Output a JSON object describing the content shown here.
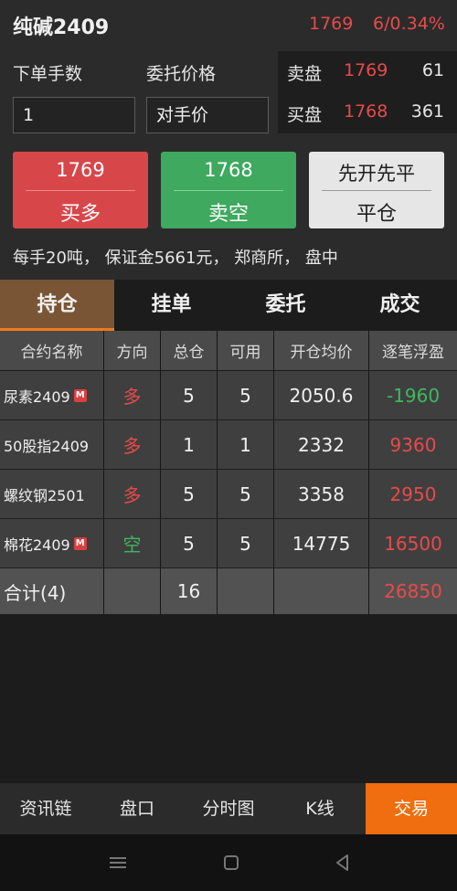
{
  "header": {
    "title": "纯碱2409",
    "last_price": "1769",
    "change": "6/0.34%"
  },
  "order_form": {
    "qty_label": "下单手数",
    "price_label": "委托价格",
    "qty_value": "1",
    "price_value": "对手价"
  },
  "order_book": [
    {
      "side": "卖盘",
      "price": "1769",
      "volume": "61"
    },
    {
      "side": "买盘",
      "price": "1768",
      "volume": "361"
    }
  ],
  "buttons": {
    "buy": {
      "price": "1769",
      "action": "买多"
    },
    "sell": {
      "price": "1768",
      "action": "卖空"
    },
    "close": {
      "mode": "先开先平",
      "action": "平仓"
    }
  },
  "info_line": "每手20吨， 保证金5661元， 郑商所， 盘中",
  "tabs": [
    "持仓",
    "挂单",
    "委托",
    "成交"
  ],
  "table": {
    "headers": [
      "合约名称",
      "方向",
      "总仓",
      "可用",
      "开仓均价",
      "逐笔浮盈"
    ],
    "rows": [
      {
        "name": "尿素2409",
        "badge": "M",
        "direction": "多",
        "total": "5",
        "available": "5",
        "avg_price": "2050.6",
        "pnl": "-1960"
      },
      {
        "name": "50股指2409",
        "badge": "",
        "direction": "多",
        "total": "1",
        "available": "1",
        "avg_price": "2332",
        "pnl": "9360"
      },
      {
        "name": "螺纹钢2501",
        "badge": "",
        "direction": "多",
        "total": "5",
        "available": "5",
        "avg_price": "3358",
        "pnl": "2950"
      },
      {
        "name": "棉花2409",
        "badge": "M",
        "direction": "空",
        "total": "5",
        "available": "5",
        "avg_price": "14775",
        "pnl": "16500"
      }
    ],
    "total": {
      "label": "合计(4)",
      "total": "16",
      "pnl": "26850"
    }
  },
  "bottom_nav": [
    "资讯链",
    "盘口",
    "分时图",
    "K线",
    "交易"
  ],
  "colors": {
    "up": "#e84a4a",
    "down": "#3fb860",
    "accent": "#f06d10"
  }
}
